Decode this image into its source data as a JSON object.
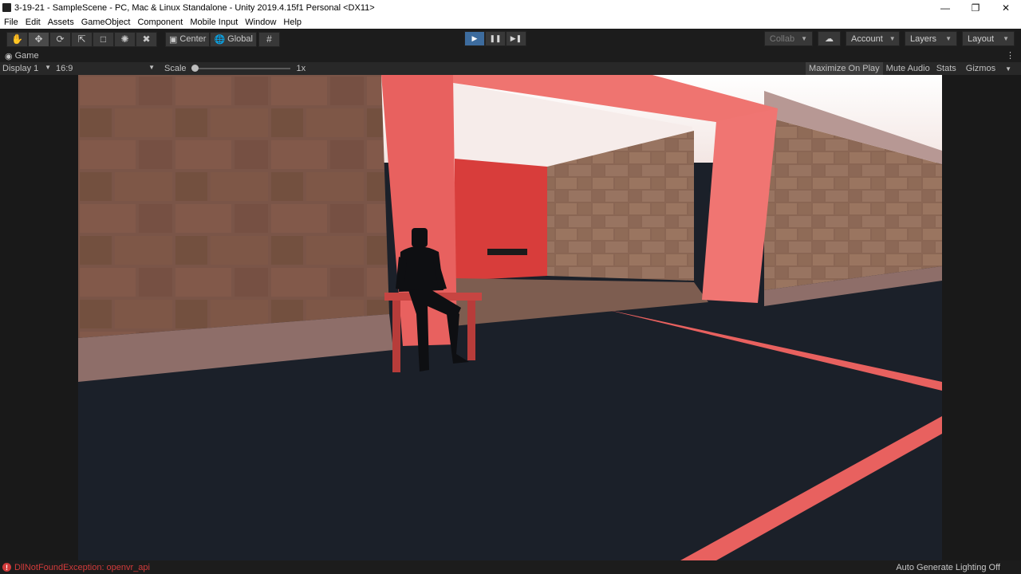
{
  "window": {
    "title": "3-19-21 - SampleScene - PC, Mac & Linux Standalone - Unity 2019.4.15f1 Personal <DX11>"
  },
  "menu": [
    "File",
    "Edit",
    "Assets",
    "GameObject",
    "Component",
    "Mobile Input",
    "Window",
    "Help"
  ],
  "toolbar": {
    "pivot_label": "Center",
    "space_label": "Global",
    "collab_label": "Collab",
    "account_label": "Account",
    "layers_label": "Layers",
    "layout_label": "Layout"
  },
  "tab": {
    "label": "Game"
  },
  "gamebar": {
    "display_label": "Display 1",
    "aspect_label": "16:9",
    "scale_label": "Scale",
    "scale_value": "1x",
    "scale_fraction": 0,
    "maximize_label": "Maximize On Play",
    "mute_label": "Mute Audio",
    "stats_label": "Stats",
    "gizmos_label": "Gizmos"
  },
  "status": {
    "error_text": "DllNotFoundException: openvr_api",
    "lighting_text": "Auto Generate Lighting Off"
  },
  "colors": {
    "play_active": "#3d6c9e",
    "error": "#d23b3b",
    "arch": "#e8615f"
  }
}
